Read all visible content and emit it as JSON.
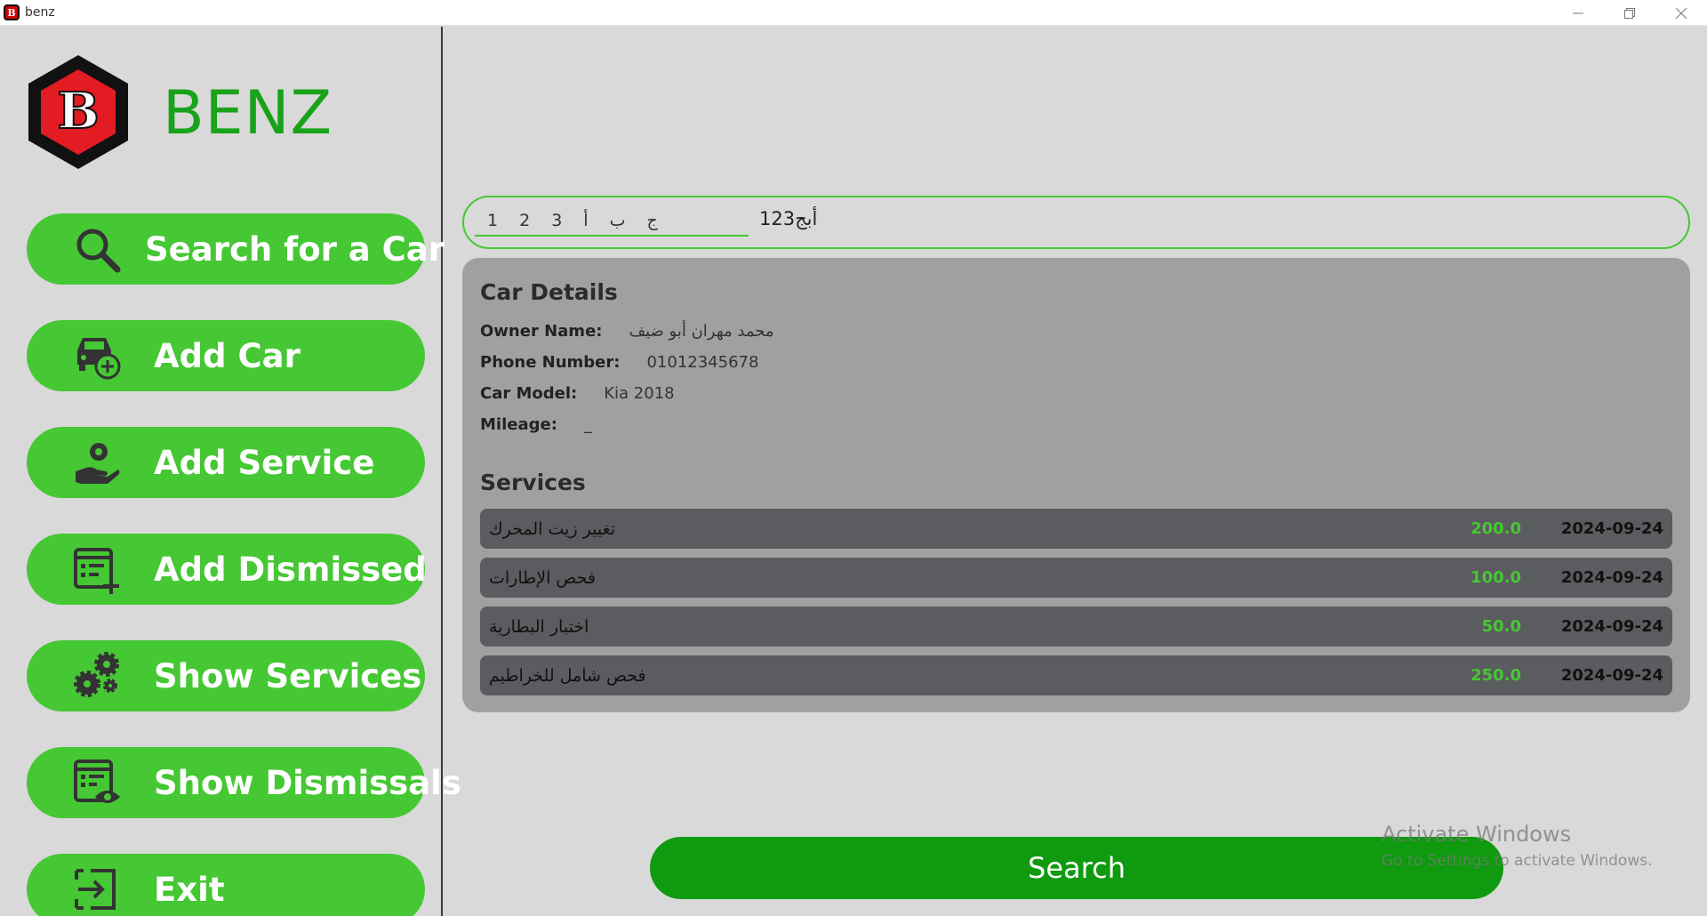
{
  "window": {
    "title": "benz",
    "app_icon_letter": "B",
    "controls": [
      "minimize",
      "restore",
      "close"
    ]
  },
  "sidebar": {
    "brand": "BENZ",
    "logo_letter": "B",
    "items": [
      {
        "label": "Search for a Car",
        "icon": "search-icon"
      },
      {
        "label": "Add Car",
        "icon": "car-add-icon"
      },
      {
        "label": "Add Service",
        "icon": "service-hand-icon"
      },
      {
        "label": "Add Dismissed",
        "icon": "list-add-icon"
      },
      {
        "label": "Show Services",
        "icon": "gears-icon"
      },
      {
        "label": "Show Dismissals",
        "icon": "document-eye-icon"
      },
      {
        "label": "Exit",
        "icon": "exit-icon"
      }
    ]
  },
  "search": {
    "keys": [
      "1",
      "2",
      "3",
      "أ",
      "ب",
      "ج"
    ],
    "value": "أبج123"
  },
  "details": {
    "title": "Car Details",
    "owner_label": "Owner Name:",
    "owner_value": "محمد مهران أبو ضيف",
    "phone_label": "Phone Number:",
    "phone_value": "01012345678",
    "model_label": "Car Model:",
    "model_value": "Kia 2018",
    "mileage_label": "Mileage:",
    "mileage_value": "_"
  },
  "services": {
    "title": "Services",
    "rows": [
      {
        "name": "تغيير زيت المحرك",
        "price": "200.0",
        "date": "2024-09-24"
      },
      {
        "name": "فحص الإطارات",
        "price": "100.0",
        "date": "2024-09-24"
      },
      {
        "name": "اختبار البطارية",
        "price": "50.0",
        "date": "2024-09-24"
      },
      {
        "name": "فحص شامل للخراطيم",
        "price": "250.0",
        "date": "2024-09-24"
      }
    ]
  },
  "search_button": "Search",
  "watermark": {
    "line1": "Activate Windows",
    "line2": "Go to Settings to activate Windows."
  },
  "colors": {
    "accent_green": "#46c734",
    "brand_green": "#18a31a",
    "search_button": "#0f9a0f",
    "logo_red": "#e31b23"
  }
}
